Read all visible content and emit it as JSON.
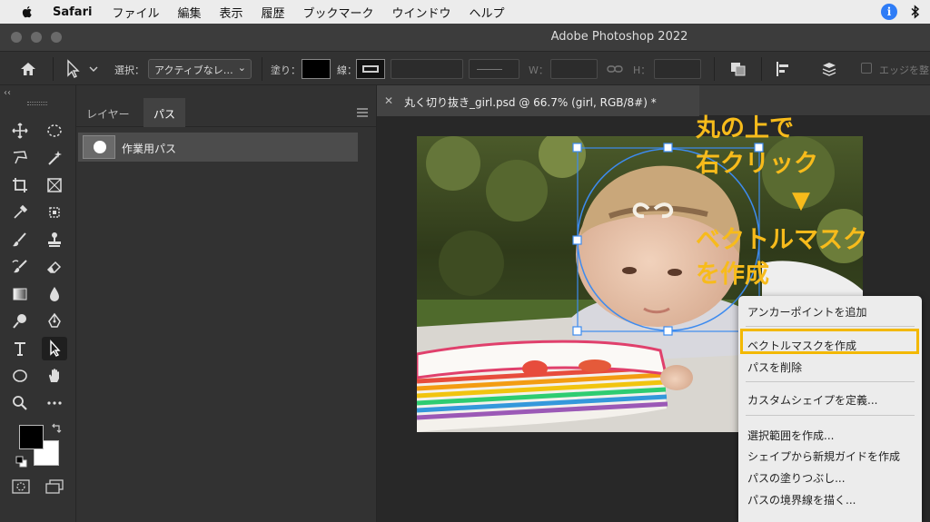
{
  "menubar": {
    "app_name": "Safari",
    "menus": [
      "ファイル",
      "編集",
      "表示",
      "履歴",
      "ブックマーク",
      "ウインドウ",
      "ヘルプ"
    ]
  },
  "window": {
    "title": "Adobe Photoshop 2022"
  },
  "options_bar": {
    "select_label": "選択：",
    "select_value": "アクティブなレ…",
    "fill_label": "塗り：",
    "stroke_label": "線：",
    "w_label": "W：",
    "h_label": "H：",
    "edge_label": "エッジを整"
  },
  "panel": {
    "tabs": [
      "レイヤー",
      "パス"
    ],
    "active_tab": "パス",
    "paths": [
      {
        "name": "作業用パス"
      }
    ]
  },
  "document": {
    "tab_title": "丸く切り抜き_girl.psd @ 66.7% (girl, RGB/8#) *"
  },
  "annotation": {
    "line1": "丸の上で",
    "line2": "右クリック",
    "arrow": "▼",
    "line3": "ベクトルマスク",
    "line4": "を作成"
  },
  "context_menu": {
    "items": [
      "アンカーポイントを追加",
      "ベクトルマスクを作成",
      "パスを削除",
      "カスタムシェイプを定義...",
      "選択範囲を作成...",
      "シェイプから新規ガイドを作成",
      "パスの塗りつぶし...",
      "パスの境界線を描く..."
    ],
    "highlighted": "ベクトルマスクを作成"
  },
  "colors": {
    "annotation": "#f7bb1b",
    "highlight_border": "#f3b800",
    "path_stroke": "#3d8bef"
  }
}
